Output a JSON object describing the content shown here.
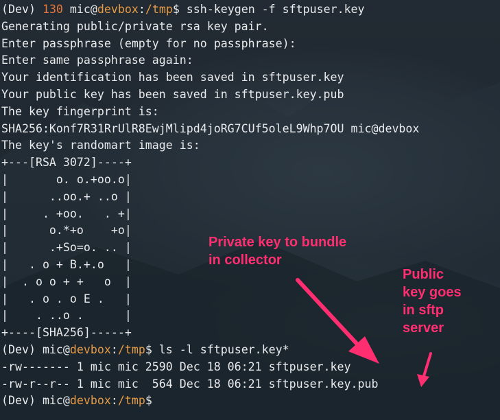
{
  "terminal": {
    "lines": [
      {
        "parts": [
          {
            "text": "(Dev) ",
            "c": ""
          },
          {
            "text": "130",
            "c": "num"
          },
          {
            "text": " mic@",
            "c": ""
          },
          {
            "text": "devbox",
            "c": "host"
          },
          {
            "text": ":",
            "c": ""
          },
          {
            "text": "/tmp",
            "c": "path"
          },
          {
            "text": "$ ssh-keygen -f sftpuser.key",
            "c": ""
          }
        ]
      },
      {
        "parts": [
          {
            "text": "Generating public/private rsa key pair.",
            "c": ""
          }
        ]
      },
      {
        "parts": [
          {
            "text": "Enter passphrase (empty for no passphrase):",
            "c": ""
          }
        ]
      },
      {
        "parts": [
          {
            "text": "Enter same passphrase again:",
            "c": ""
          }
        ]
      },
      {
        "parts": [
          {
            "text": "Your identification has been saved in sftpuser.key",
            "c": ""
          }
        ]
      },
      {
        "parts": [
          {
            "text": "Your public key has been saved in sftpuser.key.pub",
            "c": ""
          }
        ]
      },
      {
        "parts": [
          {
            "text": "The key fingerprint is:",
            "c": ""
          }
        ]
      },
      {
        "parts": [
          {
            "text": "SHA256:Konf7R31RrUlR8EwjMlipd4joRG7CUf5oleL9Whp7OU mic@devbox",
            "c": ""
          }
        ]
      },
      {
        "parts": [
          {
            "text": "The key's randomart image is:",
            "c": ""
          }
        ]
      },
      {
        "parts": [
          {
            "text": "+---[RSA 3072]----+",
            "c": ""
          }
        ]
      },
      {
        "parts": [
          {
            "text": "|       o. o.+oo.o|",
            "c": ""
          }
        ]
      },
      {
        "parts": [
          {
            "text": "|      ..oo.+ ..o |",
            "c": ""
          }
        ]
      },
      {
        "parts": [
          {
            "text": "|     . +oo.   . +|",
            "c": ""
          }
        ]
      },
      {
        "parts": [
          {
            "text": "|      o.*+o    +o|",
            "c": ""
          }
        ]
      },
      {
        "parts": [
          {
            "text": "|      .+So=o. .. |",
            "c": ""
          }
        ]
      },
      {
        "parts": [
          {
            "text": "|   . o + B.+.o   |",
            "c": ""
          }
        ]
      },
      {
        "parts": [
          {
            "text": "|  . o o + +   o  |",
            "c": ""
          }
        ]
      },
      {
        "parts": [
          {
            "text": "|   . o . o E .   |",
            "c": ""
          }
        ]
      },
      {
        "parts": [
          {
            "text": "|    . ..o .      |",
            "c": ""
          }
        ]
      },
      {
        "parts": [
          {
            "text": "+----[SHA256]-----+",
            "c": ""
          }
        ]
      },
      {
        "parts": [
          {
            "text": "(Dev) mic@",
            "c": ""
          },
          {
            "text": "devbox",
            "c": "host"
          },
          {
            "text": ":",
            "c": ""
          },
          {
            "text": "/tmp",
            "c": "path"
          },
          {
            "text": "$ ls -l sftpuser.key*",
            "c": ""
          }
        ]
      },
      {
        "parts": [
          {
            "text": "-rw------- 1 mic mic 2590 Dec 18 06:21 sftpuser.key",
            "c": ""
          }
        ]
      },
      {
        "parts": [
          {
            "text": "-rw-r--r-- 1 mic mic  564 Dec 18 06:21 sftpuser.key.pub",
            "c": ""
          }
        ]
      },
      {
        "parts": [
          {
            "text": "(Dev) mic@",
            "c": ""
          },
          {
            "text": "devbox",
            "c": "host"
          },
          {
            "text": ":",
            "c": ""
          },
          {
            "text": "/tmp",
            "c": "path"
          },
          {
            "text": "$",
            "c": ""
          }
        ]
      }
    ]
  },
  "annotations": {
    "private_key": "Private key to bundle\nin collector",
    "public_key": "Public\nkey goes\nin sftp\nserver"
  },
  "colors": {
    "prompt_number": "#e5773a",
    "prompt_host_path": "#e89b45",
    "annotation": "#ff2e70",
    "text": "#e8eaec"
  }
}
